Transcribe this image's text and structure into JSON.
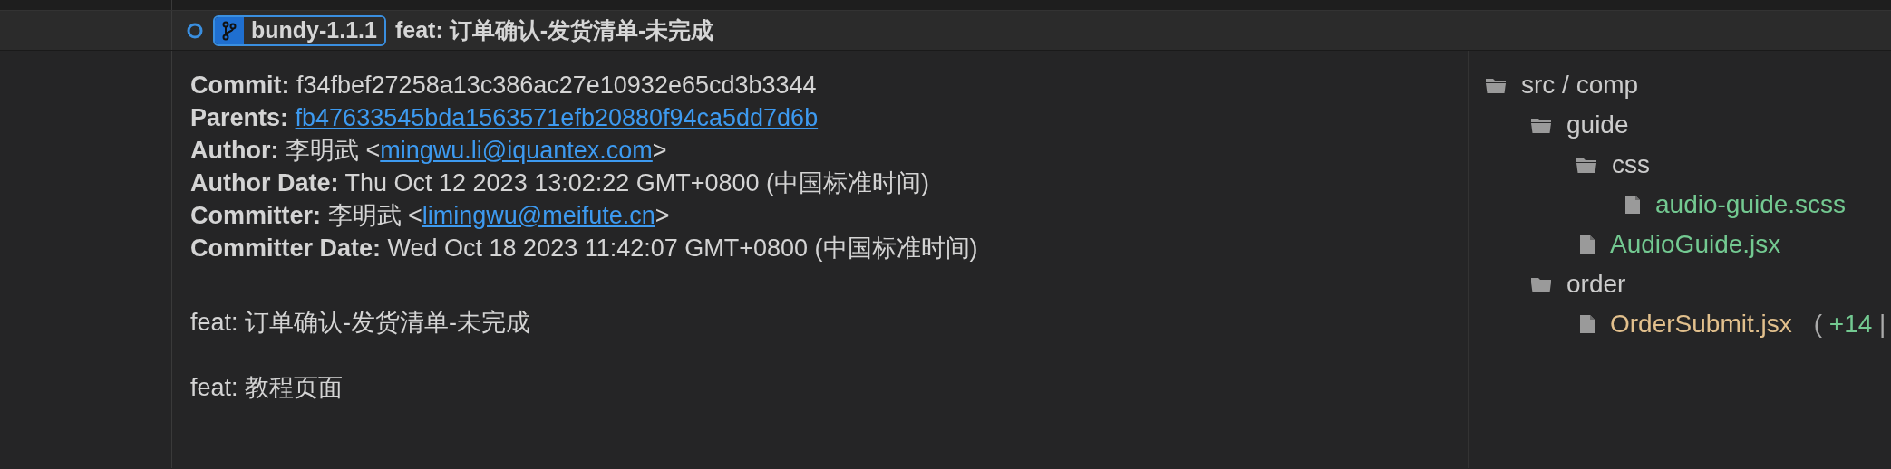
{
  "commit_row": {
    "branch_tag": "bundy-1.1.1",
    "message": "feat: 订单确认-发货清单-未完成"
  },
  "details": [
    {
      "label": "Commit:",
      "parts": [
        {
          "kind": "text",
          "text": "f34fbef27258a13c386ac27e10932e65cd3b3344"
        }
      ]
    },
    {
      "label": "Parents:",
      "parts": [
        {
          "kind": "link",
          "text": "fb47633545bda1563571efb20880f94ca5dd7d6b"
        }
      ]
    },
    {
      "label": "Author:",
      "parts": [
        {
          "kind": "text",
          "text": "李明武 <"
        },
        {
          "kind": "link",
          "text": "mingwu.li@iquantex.com"
        },
        {
          "kind": "text",
          "text": ">"
        }
      ]
    },
    {
      "label": "Author Date:",
      "parts": [
        {
          "kind": "text",
          "text": "Thu Oct 12 2023 13:02:22 GMT+0800 (中国标准时间)"
        }
      ]
    },
    {
      "label": "Committer:",
      "parts": [
        {
          "kind": "text",
          "text": "李明武 <"
        },
        {
          "kind": "link",
          "text": "limingwu@meifute.cn"
        },
        {
          "kind": "text",
          "text": ">"
        }
      ]
    },
    {
      "label": "Committer Date:",
      "parts": [
        {
          "kind": "text",
          "text": "Wed Oct 18 2023 11:42:07 GMT+0800 (中国标准时间)"
        }
      ]
    }
  ],
  "message_lines": [
    "feat: 订单确认-发货清单-未完成",
    "feat: 教程页面"
  ],
  "file_tree": [
    {
      "kind": "folder",
      "name": "src / comp",
      "children": [
        {
          "kind": "folder",
          "name": "guide",
          "children": [
            {
              "kind": "folder",
              "name": "css",
              "children": [
                {
                  "kind": "file",
                  "name": "audio-guide.scss",
                  "color": "#73c991"
                }
              ]
            },
            {
              "kind": "file",
              "name": "AudioGuide.jsx",
              "color": "#73c991"
            }
          ]
        },
        {
          "kind": "folder",
          "name": "order",
          "children": [
            {
              "kind": "file",
              "name": "OrderSubmit.jsx",
              "color": "#e2c08d",
              "stats": {
                "open": "(",
                "additions": "+14",
                "separator": "|"
              }
            }
          ]
        }
      ]
    }
  ]
}
